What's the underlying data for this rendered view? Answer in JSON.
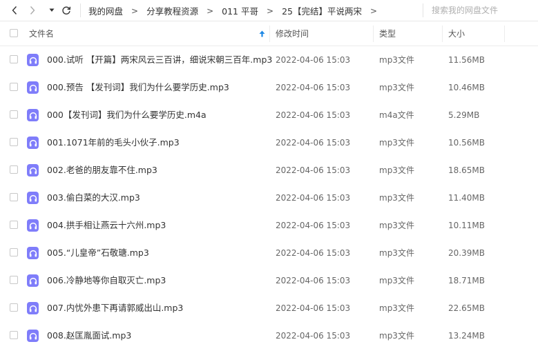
{
  "toolbar": {
    "breadcrumb": [
      "我的网盘",
      "分享教程资源",
      "011 平哥",
      "25【完结】平说两宋"
    ],
    "separator": ">",
    "search_placeholder": "搜索我的网盘文件"
  },
  "columns": {
    "name": "文件名",
    "modified": "修改时间",
    "type": "类型",
    "size": "大小"
  },
  "files": [
    {
      "name": "000.试听 【开篇】两宋风云三百讲，细说宋朝三百年.mp3",
      "modified": "2022-04-06 15:03",
      "type": "mp3文件",
      "size": "11.56MB"
    },
    {
      "name": "000.预告 【发刊词】我们为什么要学历史.mp3",
      "modified": "2022-04-06 15:03",
      "type": "mp3文件",
      "size": "10.46MB"
    },
    {
      "name": "000【发刊词】我们为什么要学历史.m4a",
      "modified": "2022-04-06 15:03",
      "type": "m4a文件",
      "size": "5.29MB"
    },
    {
      "name": "001.1071年前的毛头小伙子.mp3",
      "modified": "2022-04-06 15:03",
      "type": "mp3文件",
      "size": "10.56MB"
    },
    {
      "name": "002.老爸的朋友靠不住.mp3",
      "modified": "2022-04-06 15:03",
      "type": "mp3文件",
      "size": "18.65MB"
    },
    {
      "name": "003.偷白菜的大汉.mp3",
      "modified": "2022-04-06 15:03",
      "type": "mp3文件",
      "size": "11.40MB"
    },
    {
      "name": "004.拱手相让燕云十六州.mp3",
      "modified": "2022-04-06 15:03",
      "type": "mp3文件",
      "size": "10.11MB"
    },
    {
      "name": "005.“儿皇帝”石敬瑭.mp3",
      "modified": "2022-04-06 15:03",
      "type": "mp3文件",
      "size": "20.39MB"
    },
    {
      "name": "006.冷静地等你自取灭亡.mp3",
      "modified": "2022-04-06 15:03",
      "type": "mp3文件",
      "size": "18.71MB"
    },
    {
      "name": "007.内忧外患下再请郭威出山.mp3",
      "modified": "2022-04-06 15:03",
      "type": "mp3文件",
      "size": "22.65MB"
    },
    {
      "name": "008.赵匡胤面试.mp3",
      "modified": "2022-04-06 15:03",
      "type": "mp3文件",
      "size": "13.24MB"
    }
  ],
  "icons": {
    "back": "chevron-left-icon",
    "forward": "chevron-right-icon",
    "history": "caret-down-icon",
    "refresh": "refresh-icon",
    "sort": "sort-arrow-up-icon",
    "file": "audio-file-icon"
  },
  "colors": {
    "audio_icon": "#7f7dfa",
    "sort_arrow": "#1e88e5"
  }
}
